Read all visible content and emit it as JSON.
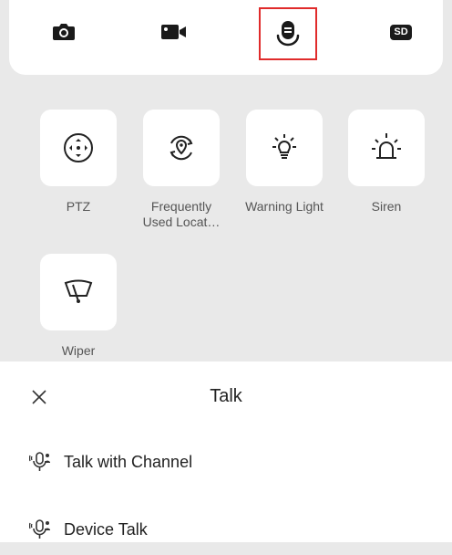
{
  "toolbar": {
    "buttons": [
      {
        "icon": "camera-icon"
      },
      {
        "icon": "video-camera-icon"
      },
      {
        "icon": "talk-icon",
        "selected": true
      },
      {
        "icon": "sd-card-icon",
        "label": "SD"
      }
    ]
  },
  "functions": [
    {
      "icon": "ptz-icon",
      "label": "PTZ"
    },
    {
      "icon": "location-refresh-icon",
      "label": "Frequently Used Locat…"
    },
    {
      "icon": "warning-light-icon",
      "label": "Warning Light"
    },
    {
      "icon": "siren-icon",
      "label": "Siren"
    },
    {
      "icon": "wiper-icon",
      "label": "Wiper"
    }
  ],
  "sheet": {
    "title": "Talk",
    "items": [
      {
        "icon": "microphone-icon",
        "label": "Talk with Channel"
      },
      {
        "icon": "microphone-icon",
        "label": "Device Talk"
      }
    ]
  }
}
